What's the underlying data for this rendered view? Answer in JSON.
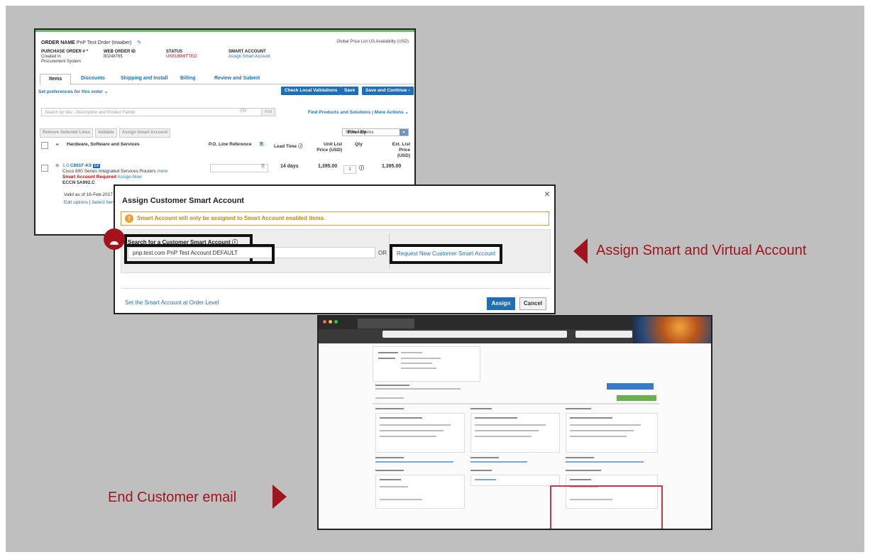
{
  "order": {
    "order_name_label": "ORDER NAME",
    "order_name_value": "PnP Test Order (trwaber)",
    "global_price_list": "Global Price List US Availability (USD)",
    "po_label": "PURCHASE ORDER # *",
    "po_value": "Created in Procurement System",
    "web_order_label": "WEB ORDER ID",
    "web_order_value": "80248765",
    "status_label": "STATUS",
    "status_value": "UNSUBMITTED",
    "smart_account_label": "SMART ACCOUNT",
    "smart_account_value": "Assign Smart Account",
    "tabs": [
      "Items",
      "Discounts",
      "Shipping and Install",
      "Billing",
      "Review and Submit"
    ],
    "set_preferences": "Set preferences for this order",
    "check_local_validations": "Check Local Validations",
    "save": "Save",
    "save_continue": "Save and Continue",
    "search_placeholder": "Search by Sku , Description and Product Family",
    "qty_placeholder": "Qty",
    "add": "Add",
    "find_products": "Find Products and Solutions | More Actions",
    "remove_selected": "Remove Selected Lines",
    "validate": "Validate",
    "assign_smart_account": "Assign Smart Account",
    "filter_by": "Filter By",
    "filter_value": "Show All Items",
    "columns": {
      "hardware": "Hardware, Software and Services",
      "po_line": "P.O. Line Reference",
      "lead_time": "Lead Time",
      "unit_list_price": "Unit List",
      "unit_list_price_2": "Price (USD)",
      "qty": "Qty",
      "ext_list_price": "Ext. List Price",
      "ext_list_price_2": "(USD)"
    },
    "line": {
      "number": "1.0",
      "sku": "C891F-K9",
      "badge": "EA",
      "description": "Cisco 890 Series Integrated Services Routers",
      "more": "more",
      "smart_required": "Smart Account Required",
      "assign_now": "Assign Now",
      "eccn": "ECCN 5A992.C",
      "lead_time": "14 days",
      "unit_price": "1,395.00",
      "qty": "1",
      "ext_price": "1,395.00",
      "valid_as_of": "Valid as of 16-Feb-2017 10:4",
      "edit_options": "Edit options",
      "select_service": "Select Servi"
    }
  },
  "modal": {
    "title": "Assign Customer Smart Account",
    "close": "×",
    "warning": "Smart Account will only be assigned to Smart Account enabled items.",
    "search_label": "Search for a Customer Smart Account",
    "search_value": "pnp.test.com PnP Test Account DEFAULT",
    "or": "OR",
    "request_new": "Request New Customer Smart Account",
    "set_at_order_level": "Set the Smart Account at Order Level",
    "assign": "Assign",
    "cancel": "Cancel"
  },
  "callouts": {
    "assign_smart_virtual": "Assign Smart and Virtual Account",
    "end_customer_email": "End Customer email"
  },
  "colors": {
    "background": "#bfbfbf",
    "accent_red": "#a0141e",
    "cisco_blue": "#1e6fb5"
  }
}
